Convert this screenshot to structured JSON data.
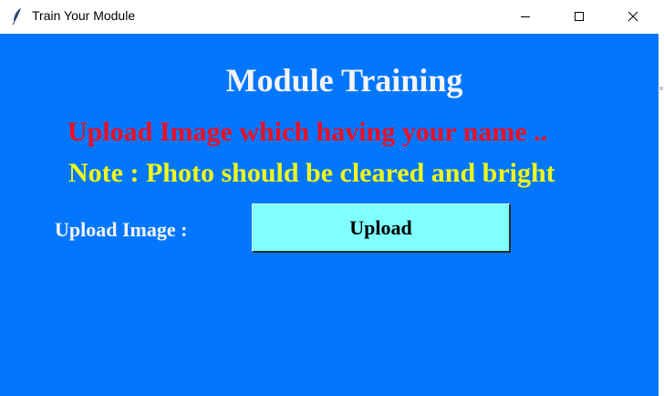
{
  "window": {
    "title": "Train Your Module",
    "icon": "feather-icon",
    "controls": [
      "minimize-icon",
      "maximize-icon",
      "close-icon"
    ]
  },
  "main": {
    "heading": "Module Training",
    "instruction": "Upload Image which having your name ..",
    "note": "Note : Photo should be cleared and bright",
    "upload_label": "Upload Image :",
    "upload_button": "Upload"
  },
  "colors": {
    "background": "#0277fd",
    "heading": "#f4f4f4",
    "instruction": "#f00e22",
    "note": "#eff81a",
    "button_bg": "#80ffff"
  }
}
